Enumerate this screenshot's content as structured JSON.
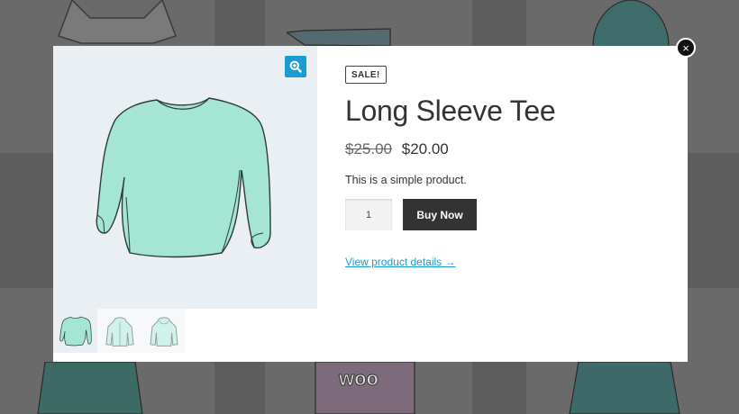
{
  "modal": {
    "badge": "SALE!",
    "title": "Long Sleeve Tee",
    "price_old": "$25.00",
    "price_new": "$20.00",
    "description": "This is a simple product.",
    "quantity": "1",
    "buy_label": "Buy Now",
    "details_link": "View product details →",
    "close_symbol": "×"
  },
  "gallery": {
    "main_image": "long-sleeve-tee-image",
    "zoom_icon": "zoom-in-icon",
    "thumbnails": [
      "long-sleeve-tee",
      "hoodie-front",
      "hoodie-back"
    ],
    "active_thumbnail": 0
  },
  "colors": {
    "accent": "#1a9bd1",
    "button": "#333333",
    "gallery_bg": "#e9eff3",
    "shirt": "#a4e6d2"
  }
}
